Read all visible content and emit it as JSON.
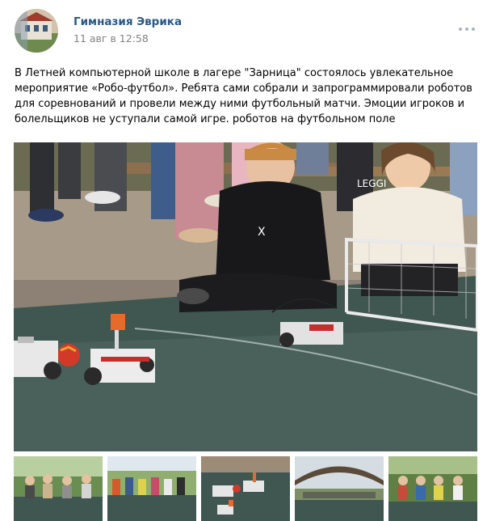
{
  "post": {
    "author": "Гимназия Эврика",
    "date": "11 авг в 12:58",
    "text": "В Летней компьютерной школе в лагере \"Зарница\" состоялось увлекательное мероприятие «Робо-футбол». Ребята сами собрали и запрограммировали роботов для соревнований и провели между ними футбольный матчи. Эмоции игроков и болельщиков не уступали самой игре. роботов на футбольном поле",
    "more_icon": "more-horizontal-icon"
  },
  "photo": {
    "sweatshirt_text": "LEGGI"
  },
  "thumbnails": [
    {
      "subject": "audience"
    },
    {
      "subject": "crowd"
    },
    {
      "subject": "robots"
    },
    {
      "subject": "pavilion"
    },
    {
      "subject": "spectators"
    }
  ]
}
